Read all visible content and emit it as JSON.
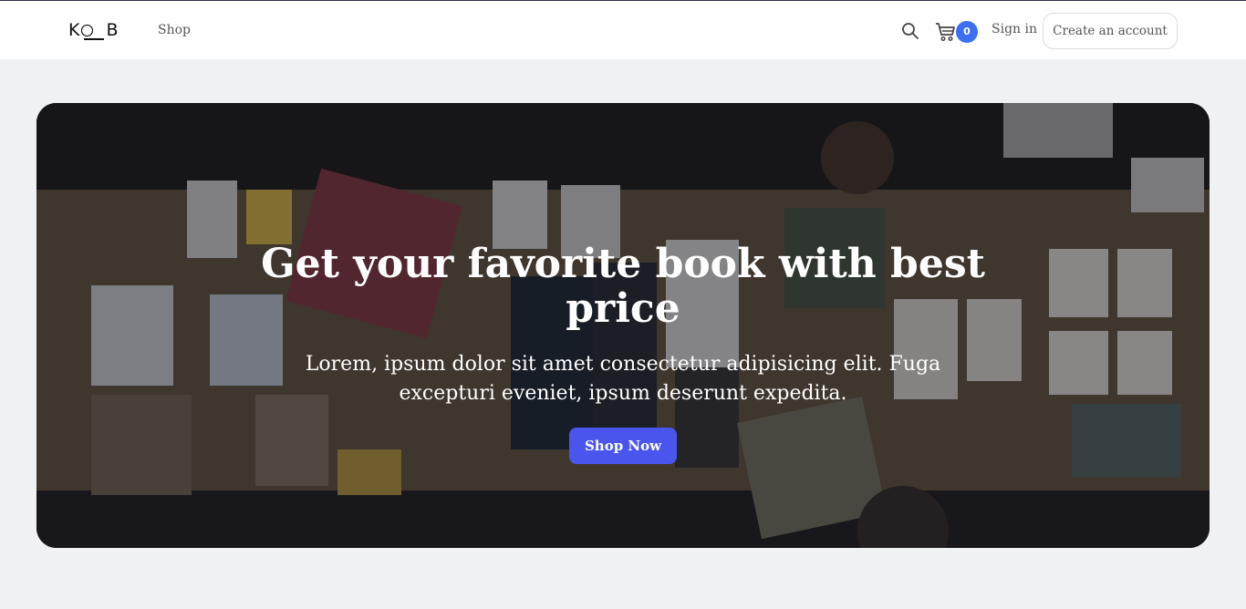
{
  "header": {
    "logo_text": "KOOB",
    "nav": {
      "shop_label": "Shop"
    },
    "cart_count": "0",
    "signin_label": "Sign in",
    "create_account_label": "Create an account",
    "badge_color": "#3b6ff0"
  },
  "hero": {
    "title": "Get your favorite book with best price",
    "subtitle": "Lorem, ipsum dolor sit amet consectetur adipisicing elit. Fuga excepturi eveniet, ipsum deserunt expedita.",
    "cta_label": "Shop Now",
    "cta_color": "#4a55ee"
  },
  "icons": {
    "search": "search-icon",
    "cart": "cart-icon"
  }
}
